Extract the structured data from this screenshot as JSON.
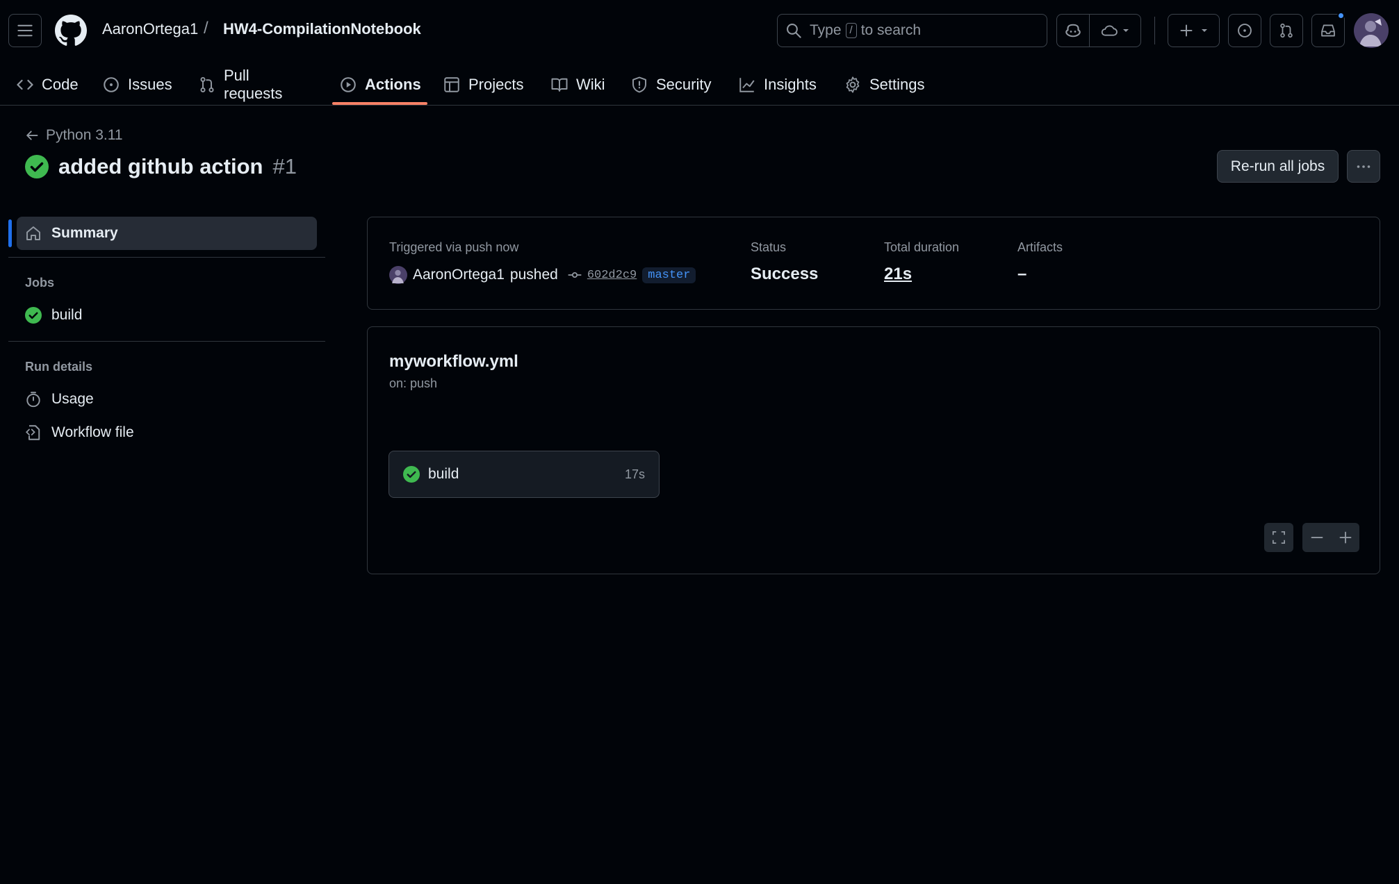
{
  "header": {
    "owner": "AaronOrtega1",
    "separator": "/",
    "repo": "HW4-CompilationNotebook",
    "search_prefix": "Type",
    "search_key": "/",
    "search_suffix": "to search"
  },
  "tabs": [
    {
      "label": "Code",
      "icon": "code-icon"
    },
    {
      "label": "Issues",
      "icon": "issue-icon"
    },
    {
      "label": "Pull requests",
      "icon": "pull-request-icon"
    },
    {
      "label": "Actions",
      "icon": "play-icon",
      "active": true
    },
    {
      "label": "Projects",
      "icon": "table-icon"
    },
    {
      "label": "Wiki",
      "icon": "book-icon"
    },
    {
      "label": "Security",
      "icon": "shield-icon"
    },
    {
      "label": "Insights",
      "icon": "graph-icon"
    },
    {
      "label": "Settings",
      "icon": "gear-icon"
    }
  ],
  "run": {
    "workflow_name": "Python 3.11",
    "title": "added github action",
    "number": "#1",
    "rerun_label": "Re-run all jobs"
  },
  "sidebar": {
    "summary_label": "Summary",
    "jobs_heading": "Jobs",
    "jobs": [
      {
        "label": "build",
        "status": "success"
      }
    ],
    "run_details_heading": "Run details",
    "details": [
      {
        "label": "Usage",
        "icon": "stopwatch-icon"
      },
      {
        "label": "Workflow file",
        "icon": "file-code-icon"
      }
    ]
  },
  "summary": {
    "trigger_label": "Triggered via push now",
    "actor": "AaronOrtega1",
    "action": "pushed",
    "commit_sha": "602d2c9",
    "branch": "master",
    "status_label": "Status",
    "status_value": "Success",
    "duration_label": "Total duration",
    "duration_value": "21s",
    "artifacts_label": "Artifacts",
    "artifacts_value": "–"
  },
  "workflow": {
    "file": "myworkflow.yml",
    "trigger": "on: push",
    "job_name": "build",
    "job_duration": "17s"
  },
  "colors": {
    "success": "#3fb950",
    "accent": "#1f6feb",
    "tab_underline": "#f78166"
  }
}
